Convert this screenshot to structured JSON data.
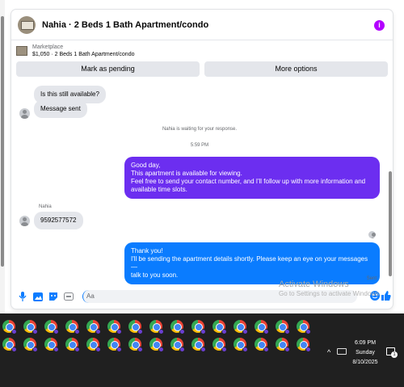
{
  "header": {
    "title": "Nahia · 2 Beds 1 Bath Apartment/condo",
    "info_icon": "info-icon",
    "accent": "#b300ff"
  },
  "marketplace": {
    "label": "Marketplace",
    "item": "$1,050 · 2 Beds 1 Bath Apartment/condo"
  },
  "actions": {
    "mark_pending": "Mark as pending",
    "more_options": "More options"
  },
  "messages": {
    "q_available": "Is this still available?",
    "message_sent": "Message sent",
    "waiting": "Nahia is waiting for your response.",
    "time": "5:59 PM",
    "out1_lines": [
      "Good day,",
      "This apartment is available for viewing.",
      "Feel free to send your contact number, and I'll follow up with more information and",
      "available time slots."
    ],
    "sender": "Nahia",
    "in_phone": "9592577572",
    "out2_lines": [
      "Thank you!",
      "I'll be sending the apartment details shortly. Please keep an eye on your messages—",
      "talk to you soon."
    ],
    "status": "Sent",
    "out1_color": "#6c2ef0",
    "out2_color": "#0a7cff"
  },
  "compose": {
    "placeholder": "Aa",
    "icons": [
      "microphone-icon",
      "photo-icon",
      "sticker-icon",
      "gif-icon",
      "emoji-icon",
      "thumbs-up-icon"
    ]
  },
  "watermark": {
    "line1": "Activate Windows",
    "line2": "Go to Settings to activate Windows."
  },
  "taskbar": {
    "time": "6:09 PM",
    "day": "Sunday",
    "date": "8/10/2025",
    "notification_count": "1"
  }
}
